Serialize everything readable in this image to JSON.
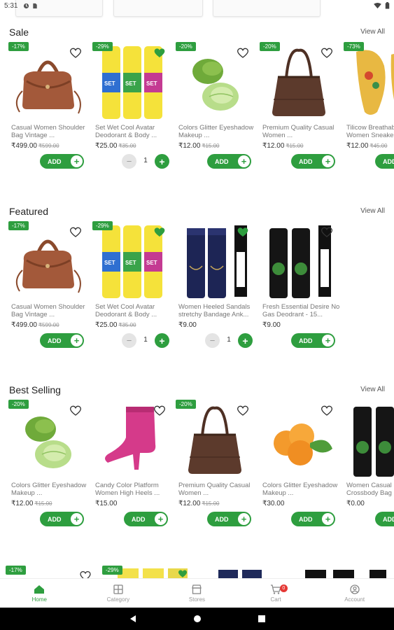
{
  "status_bar": {
    "time": "5:31"
  },
  "top_cards": [
    "",
    "",
    ""
  ],
  "sections": [
    {
      "title": "Sale",
      "view_all": "View All",
      "products": [
        {
          "discount": "-17%",
          "name": "Casual Women Shoulder Bag Vintage ...",
          "price": "₹499.00",
          "old_price": "₹599.00",
          "image": "handbag-tan",
          "action": "add",
          "fav_filled": false
        },
        {
          "discount": "-29%",
          "name": "Set Wet Cool Avatar Deodorant & Body ...",
          "price": "₹25.00",
          "old_price": "₹35.00",
          "image": "deodorant-set",
          "action": "stepper",
          "qty": "1",
          "fav_filled": true
        },
        {
          "discount": "-20%",
          "name": "Colors Glitter Eyeshadow Makeup ...",
          "price": "₹12.00",
          "old_price": "₹15.00",
          "image": "lettuce",
          "action": "add",
          "fav_filled": false
        },
        {
          "discount": "-20%",
          "name": "Premium Quality Casual Women ...",
          "price": "₹12.00",
          "old_price": "₹15.00",
          "image": "handbag-brown",
          "action": "add",
          "fav_filled": false
        },
        {
          "discount": "-73%",
          "name": "Tilicow Breathable Women Sneakers",
          "price": "₹12.00",
          "old_price": "₹45.00",
          "image": "sandals",
          "action": "add",
          "fav_filled": false
        }
      ]
    },
    {
      "title": "Featured",
      "view_all": "View All",
      "products": [
        {
          "discount": "-17%",
          "name": "Casual Women Shoulder Bag Vintage ...",
          "price": "₹499.00",
          "old_price": "₹599.00",
          "image": "handbag-tan",
          "action": "add",
          "fav_filled": false
        },
        {
          "discount": "-29%",
          "name": "Set Wet Cool Avatar Deodorant & Body ...",
          "price": "₹25.00",
          "old_price": "₹35.00",
          "image": "deodorant-set",
          "action": "stepper",
          "qty": "1",
          "fav_filled": true
        },
        {
          "discount": "",
          "name": "Women Heeled Sandals stretchy Bandage Ank...",
          "price": "₹9.00",
          "old_price": "",
          "image": "spray-navy",
          "action": "stepper",
          "qty": "1",
          "fav_filled": true
        },
        {
          "discount": "",
          "name": "Fresh Essential Desire No Gas Deodrant - 15...",
          "price": "₹9.00",
          "old_price": "",
          "image": "spray-black",
          "action": "add",
          "fav_filled": false
        }
      ]
    },
    {
      "title": "Best Selling",
      "view_all": "View All",
      "products": [
        {
          "discount": "-20%",
          "name": "Colors Glitter Eyeshadow Makeup ...",
          "price": "₹12.00",
          "old_price": "₹15.00",
          "image": "lettuce",
          "action": "add",
          "fav_filled": false
        },
        {
          "discount": "",
          "name": "Candy Color Platform Women High Heels ...",
          "price": "₹15.00",
          "old_price": "",
          "image": "boot-pink",
          "action": "add",
          "fav_filled": false
        },
        {
          "discount": "-20%",
          "name": "Premium Quality Casual Women ...",
          "price": "₹12.00",
          "old_price": "₹15.00",
          "image": "handbag-brown",
          "action": "add",
          "fav_filled": false
        },
        {
          "discount": "",
          "name": "Colors Glitter Eyeshadow Makeup ...",
          "price": "₹30.00",
          "old_price": "",
          "image": "apricots",
          "action": "add",
          "fav_filled": false
        },
        {
          "discount": "",
          "name": "Women Casual Crossbody Bag",
          "price": "₹0.00",
          "old_price": "",
          "image": "spray-black",
          "action": "add",
          "fav_filled": false
        }
      ]
    }
  ],
  "add_label": "ADD",
  "peek_row": {
    "discounts": [
      "-17%",
      "-29%"
    ]
  },
  "bottom_nav": [
    {
      "label": "Home",
      "icon": "home-icon",
      "active": true
    },
    {
      "label": "Category",
      "icon": "category-icon",
      "active": false
    },
    {
      "label": "Stores",
      "icon": "store-icon",
      "active": false
    },
    {
      "label": "Cart",
      "icon": "cart-icon",
      "active": false,
      "badge": "0"
    },
    {
      "label": "Account",
      "icon": "account-icon",
      "active": false
    }
  ],
  "colors": {
    "accent": "#2e9e3f",
    "badge": "#e53935"
  }
}
